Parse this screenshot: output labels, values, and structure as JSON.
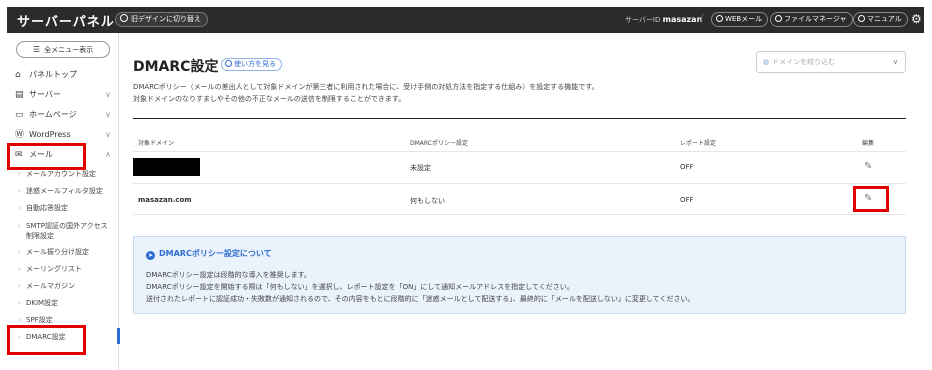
{
  "header": {
    "brand": "サーバーパネル",
    "old_design_button": "旧デザインに切り替え",
    "server_id_label": "サーバーID",
    "server_id_value": "masazan",
    "separator": "/",
    "webmail_button": "WEBメール",
    "file_manager_button": "ファイルマネージャ",
    "manual_button": "マニュアル",
    "gear_icon": "gear-icon"
  },
  "sidebar": {
    "menu_button": "全メニュー表示",
    "items": [
      {
        "label": "パネルトップ",
        "icon": "home-icon",
        "chevron": ""
      },
      {
        "label": "サーバー",
        "icon": "server-icon",
        "chevron": "∨"
      },
      {
        "label": "ホームページ",
        "icon": "browser-icon",
        "chevron": "∨"
      },
      {
        "label": "WordPress",
        "icon": "wordpress-icon",
        "chevron": "∨"
      },
      {
        "label": "メール",
        "icon": "mail-icon",
        "chevron": "∧"
      }
    ],
    "mail_subitems": [
      "メールアカウント設定",
      "迷惑メールフィルタ設定",
      "自動応答設定",
      "SMTP認証の国外アクセス制限設定",
      "メール振り分け設定",
      "メーリングリスト",
      "メールマガジン",
      "DKIM設定",
      "SPF設定",
      "DMARC設定"
    ]
  },
  "main": {
    "title": "DMARC設定",
    "howto_button": "使い方を見る",
    "domain_filter_placeholder": "ドメインを絞り込む",
    "description": [
      "DMARCポリシー（メールの差出人として対象ドメインが第三者に利用された場合に、受け手側の対処方法を指定する仕組み）を設定する機能です。",
      "対象ドメインのなりすましやその他の不正なメールの送信を制限することができます。"
    ],
    "table": {
      "headers": [
        "対象ドメイン",
        "DMARCポリシー設定",
        "レポート設定",
        "編集"
      ],
      "rows": [
        {
          "domain": "",
          "policy": "未設定",
          "report": "OFF"
        },
        {
          "domain": "masazan.com",
          "policy": "何もしない",
          "report": "OFF"
        }
      ]
    },
    "info": {
      "title": "DMARCポリシー設定について",
      "lines": [
        "DMARCポリシー設定は段階的な導入を推奨します。",
        "DMARCポリシー設定を開始する際は「何もしない」を選択し、レポート設定を「ON」にして通知メールアドレスを指定してください。",
        "送付されたレポートに認証成功・失敗数が通知されるので、その内容をもとに段階的に「迷惑メールとして配送する」、最終的に「メールを配送しない」に変更してください。"
      ]
    }
  },
  "colors": {
    "accent": "#2e6bd1",
    "header_bg": "#2b2b2b",
    "highlight_box": "#e00000",
    "info_bg": "#eaf2fb"
  }
}
